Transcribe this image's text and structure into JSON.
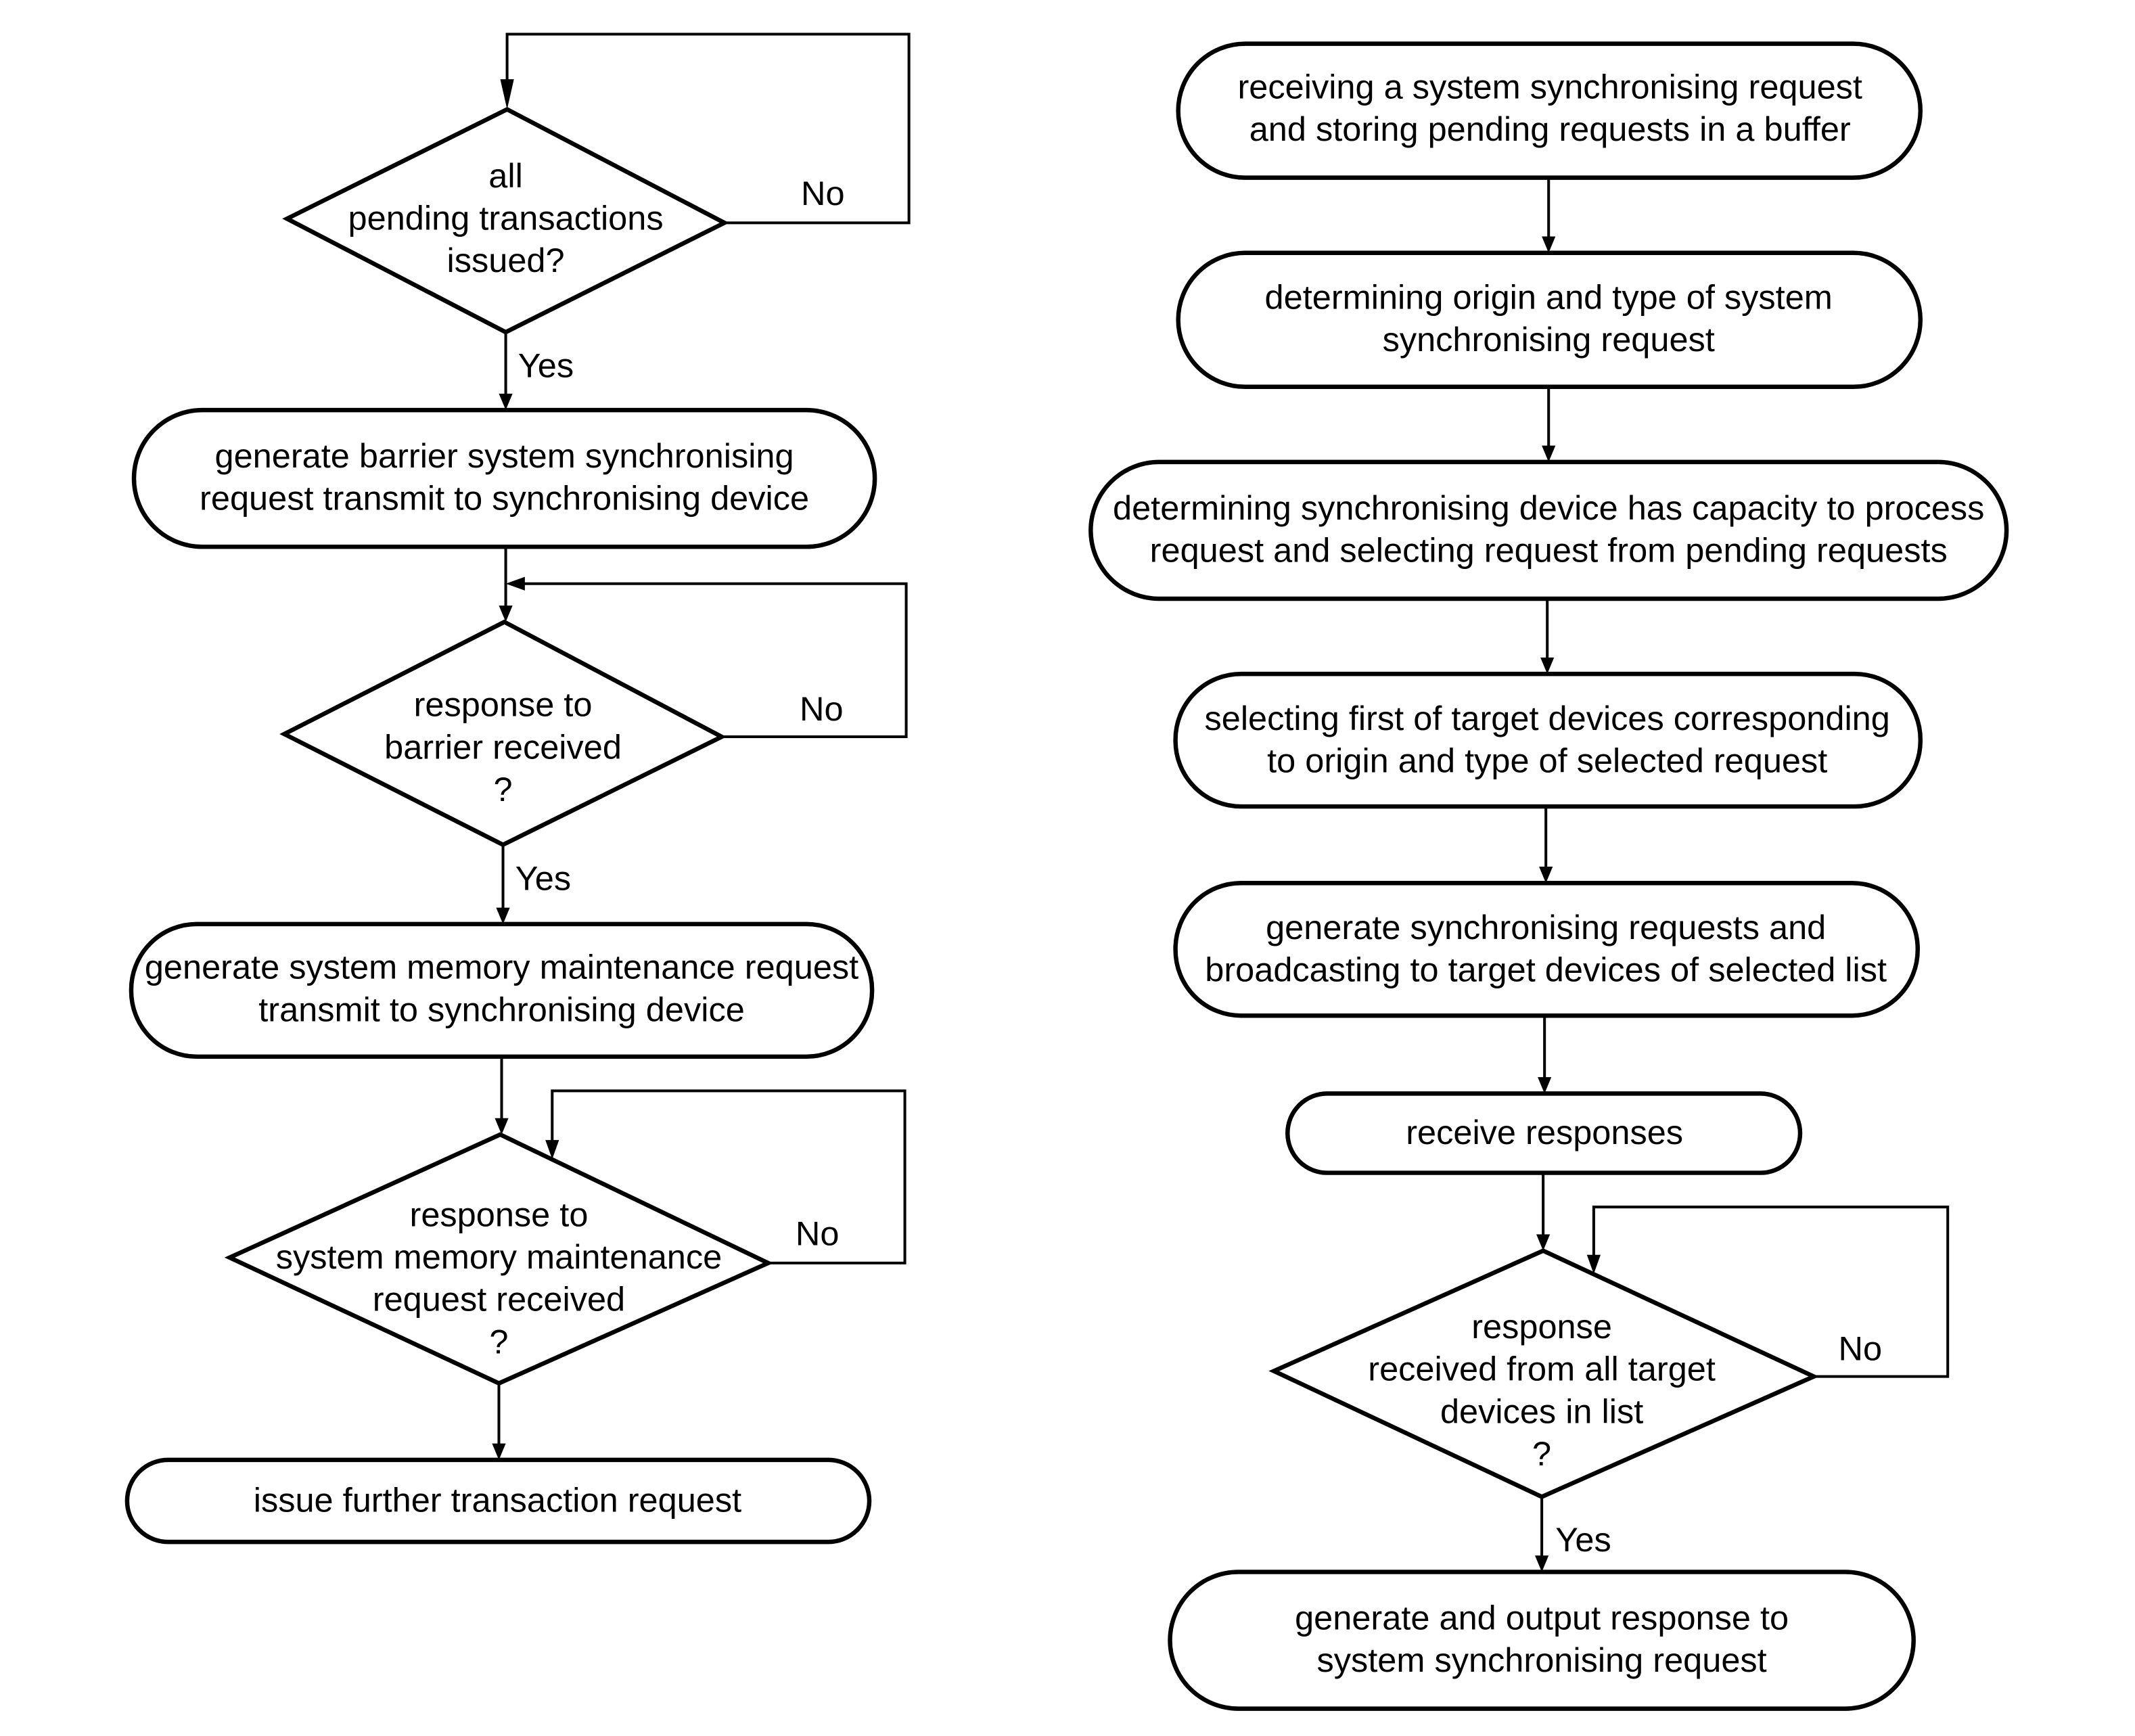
{
  "left_flow": {
    "decision_1": {
      "lines": [
        "all",
        "pending transactions",
        "issued?"
      ],
      "yes": "Yes",
      "no": "No"
    },
    "step_1": {
      "lines": [
        "generate barrier system synchronising",
        "request transmit to synchronising device"
      ]
    },
    "decision_2": {
      "lines": [
        "response to",
        "barrier received",
        "?"
      ],
      "yes": "Yes",
      "no": "No"
    },
    "step_2": {
      "lines": [
        "generate system memory maintenance request",
        "transmit to synchronising device"
      ]
    },
    "decision_3": {
      "lines": [
        "response to",
        "system memory maintenance",
        "request received",
        "?"
      ],
      "no": "No"
    },
    "step_3": {
      "lines": [
        "issue further transaction request"
      ]
    }
  },
  "right_flow": {
    "step_1": {
      "lines": [
        "receiving a system synchronising request",
        "and storing pending requests in a buffer"
      ]
    },
    "step_2": {
      "lines": [
        "determining origin and type of system",
        "synchronising request"
      ]
    },
    "step_3": {
      "lines": [
        "determining synchronising device has capacity to process",
        "request and selecting request from pending requests"
      ]
    },
    "step_4": {
      "lines": [
        "selecting first of target devices corresponding",
        "to origin and type of selected request"
      ]
    },
    "step_5": {
      "lines": [
        "generate synchronising requests and",
        "broadcasting to target devices of selected list"
      ]
    },
    "step_6": {
      "lines": [
        "receive responses"
      ]
    },
    "decision_1": {
      "lines": [
        "response",
        "received from all target",
        "devices in list",
        "?"
      ],
      "yes": "Yes",
      "no": "No"
    },
    "step_7": {
      "lines": [
        "generate and output response to",
        "system synchronising request"
      ]
    }
  }
}
